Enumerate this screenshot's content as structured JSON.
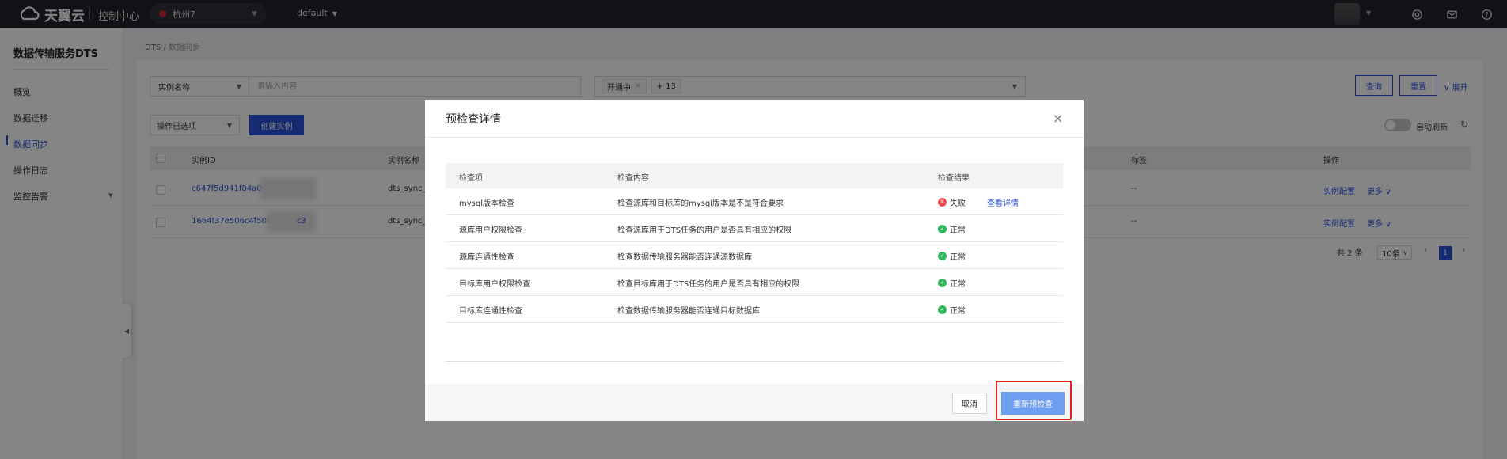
{
  "topbar": {
    "logo_text": "天翼云",
    "console_label": "控制中心",
    "region": "杭州7",
    "project": "default"
  },
  "sidebar": {
    "title": "数据传输服务DTS",
    "items": [
      {
        "label": "概览"
      },
      {
        "label": "数据迁移"
      },
      {
        "label": "数据同步"
      },
      {
        "label": "操作日志"
      },
      {
        "label": "监控告警"
      }
    ]
  },
  "breadcrumb": {
    "root": "DTS",
    "separator": "/",
    "current": "数据同步"
  },
  "filters": {
    "field_select": "实例名称",
    "search_placeholder": "请输入内容",
    "status_chip": "开通中",
    "more_chip": "+ 13",
    "query_label": "查询",
    "reset_label": "重置",
    "expand_label": "展开"
  },
  "actions": {
    "op_select": "操作已选项",
    "create_label": "创建实例",
    "auto_refresh_label": "自动刷新"
  },
  "table": {
    "headers": {
      "id": "实例ID",
      "name": "实例名称",
      "tag": "标签",
      "op": "操作"
    },
    "rows": [
      {
        "id": "c647f5d941f84a0c",
        "name": "dts_sync_",
        "tag": "--",
        "config": "实例配置",
        "more": "更多"
      },
      {
        "id": "1664f37e506c4f508",
        "id_tail": "c3",
        "name": "dts_sync_",
        "tag": "--",
        "config": "实例配置",
        "more": "更多"
      }
    ]
  },
  "pagination": {
    "total": "共 2 条",
    "page_size": "10条",
    "current_page": "1"
  },
  "modal": {
    "title": "预检查详情",
    "columns": {
      "item": "检查项",
      "content": "检查内容",
      "result": "检查结果"
    },
    "rows": [
      {
        "item": "mysql版本检查",
        "content": "检查源库和目标库的mysql版本是不是符合要求",
        "result": "失败",
        "status": "fail",
        "detail": "查看详情"
      },
      {
        "item": "源库用户权限检查",
        "content": "检查源库用于DTS任务的用户是否具有相应的权限",
        "result": "正常",
        "status": "ok"
      },
      {
        "item": "源库连通性检查",
        "content": "检查数据传输服务器能否连通源数据库",
        "result": "正常",
        "status": "ok"
      },
      {
        "item": "目标库用户权限检查",
        "content": "检查目标库用于DTS任务的用户是否具有相应的权限",
        "result": "正常",
        "status": "ok"
      },
      {
        "item": "目标库连通性检查",
        "content": "检查数据传输服务器能否连通目标数据库",
        "result": "正常",
        "status": "ok"
      }
    ],
    "cancel_label": "取消",
    "recheck_label": "重新预检查"
  },
  "colors": {
    "primary": "#2b52d8",
    "highlight": "#e8201c",
    "fail": "#ee4d4d",
    "ok": "#2fb85c"
  }
}
